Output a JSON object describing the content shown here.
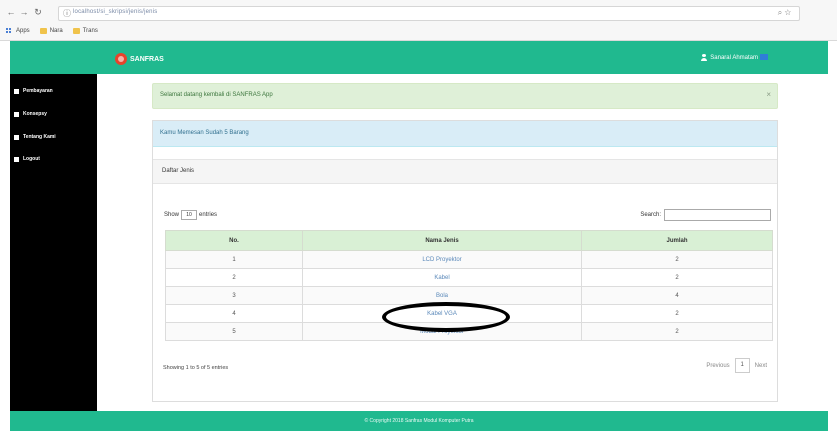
{
  "browser": {
    "url_host": "localhost",
    "url_path": "/si_skripsi/jenis/jenis",
    "bookmarks": [
      "Apps",
      "Nara",
      "Trans"
    ]
  },
  "header": {
    "brand": "SANFRAS",
    "user": "Sanaral Ahmatam"
  },
  "sidebar": {
    "items": [
      {
        "label": "Pembayaran",
        "icon": "cart-icon"
      },
      {
        "label": "Konsepsy",
        "icon": "heart-icon"
      },
      {
        "label": "Tentang Kami",
        "icon": "info-icon"
      },
      {
        "label": "Logout",
        "icon": "power-icon"
      }
    ]
  },
  "alert": {
    "text": "Selamat datang kembali di SANFRAS App",
    "close": "×"
  },
  "panel": {
    "heading": "Kamu Memesan Sudah 5 Barang",
    "subheading": "Daftar Jenis"
  },
  "controls": {
    "show_label": "Show",
    "show_value": "10",
    "entries_label": "entries",
    "search_label": "Search:"
  },
  "table": {
    "headers": [
      "No.",
      "Nama Jenis",
      "Jumlah"
    ],
    "rows": [
      [
        "1",
        "LCD Proyektor",
        "2"
      ],
      [
        "2",
        "Kabel",
        "2"
      ],
      [
        "3",
        "Bola",
        "4"
      ],
      [
        "4",
        "Kabel VGA",
        "2"
      ],
      [
        "5",
        "Modul Proyektor",
        "2"
      ]
    ]
  },
  "footer_info": {
    "entries_info": "Showing 1 to 5 of 5 entries",
    "prev": "Previous",
    "page": "1",
    "next": "Next"
  },
  "footer": {
    "text": "© Copyright 2018 Sanfras Modul Komputer Putra"
  }
}
